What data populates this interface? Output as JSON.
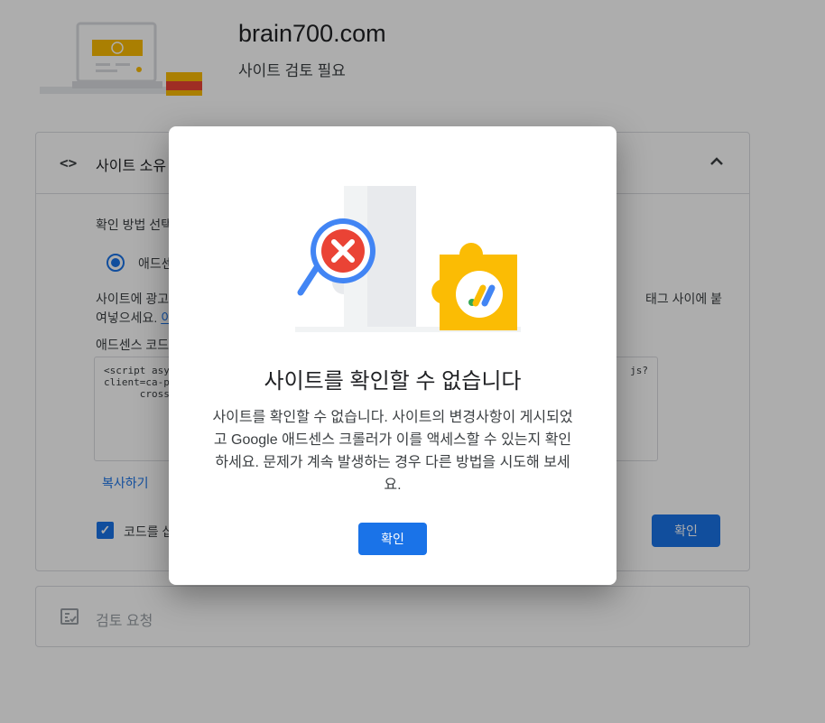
{
  "header": {
    "site_name": "brain700.com",
    "site_status": "사이트 검토 필요"
  },
  "ownership_card": {
    "title": "사이트 소유",
    "method_label": "확인 방법 선택",
    "radio_label": "애드센",
    "instruction_left": "사이트에 광고",
    "instruction_right": "태그 사이에 붙",
    "instruction_line2": "여넣으세요.",
    "instruction_link": "이",
    "code_label": "애드센스 코드",
    "code_lines": [
      "<script asy",
      "client=ca-p",
      "      cross"
    ],
    "code_tail": "js?",
    "copy_label": "복사하기",
    "checkbox_label": "코드를 삽",
    "verify_label": "확인"
  },
  "review_card": {
    "title": "검토 요청"
  },
  "dialog": {
    "title": "사이트를 확인할 수 없습니다",
    "body": "사이트를 확인할 수 없습니다. 사이트의 변경사항이 게시되었고 Google 애드센스 크롤러가 이를 액세스할 수 있는지 확인하세요. 문제가 계속 발생하는 경우 다른 방법을 시도해 보세요.",
    "ok_label": "확인"
  },
  "colors": {
    "primary": "#1a73e8",
    "error": "#ea4335",
    "adsense_yellow": "#fbbc04",
    "green": "#34a853"
  },
  "icons": {
    "code": "code-brackets-icon",
    "collapse": "chevron-up-icon",
    "review": "review-checklist-icon",
    "error": "magnifier-error-icon",
    "adsense": "adsense-logo-icon"
  }
}
